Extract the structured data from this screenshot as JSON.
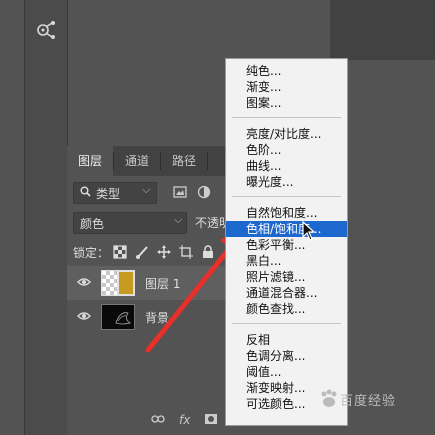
{
  "tabs": [
    {
      "label": "图层",
      "active": true
    },
    {
      "label": "通道",
      "active": false
    },
    {
      "label": "路径",
      "active": false
    }
  ],
  "filter": {
    "type_label": "类型",
    "search_icon": "search-icon",
    "chevron": "⌵"
  },
  "blend": {
    "mode": "颜色",
    "opacity_label": "不透明度"
  },
  "lock": {
    "label": "锁定："
  },
  "layers": [
    {
      "name": "图层 1",
      "thumbnail": "gold-fill",
      "visible": true,
      "selected": true
    },
    {
      "name": "背景",
      "thumbnail": "dark-image",
      "visible": true,
      "selected": false
    }
  ],
  "bottom": {
    "fx": "fx"
  },
  "menu": {
    "groups": [
      [
        "纯色...",
        "渐变...",
        "图案..."
      ],
      [
        "亮度/对比度...",
        "色阶...",
        "曲线...",
        "曝光度..."
      ],
      [
        "自然饱和度...",
        "色相/饱和度...",
        "色彩平衡...",
        "黑白...",
        "照片滤镜...",
        "通道混合器...",
        "颜色查找..."
      ],
      [
        "反相",
        "色调分离...",
        "阈值...",
        "渐变映射...",
        "可选颜色..."
      ]
    ],
    "highlighted": "色相/饱和度..."
  },
  "colors": {
    "menu_highlight": "#1d68cf",
    "annotation_arrow": "#e8302a",
    "layer_fill": "#c79a21"
  },
  "watermark": {
    "text": "百度经验"
  }
}
